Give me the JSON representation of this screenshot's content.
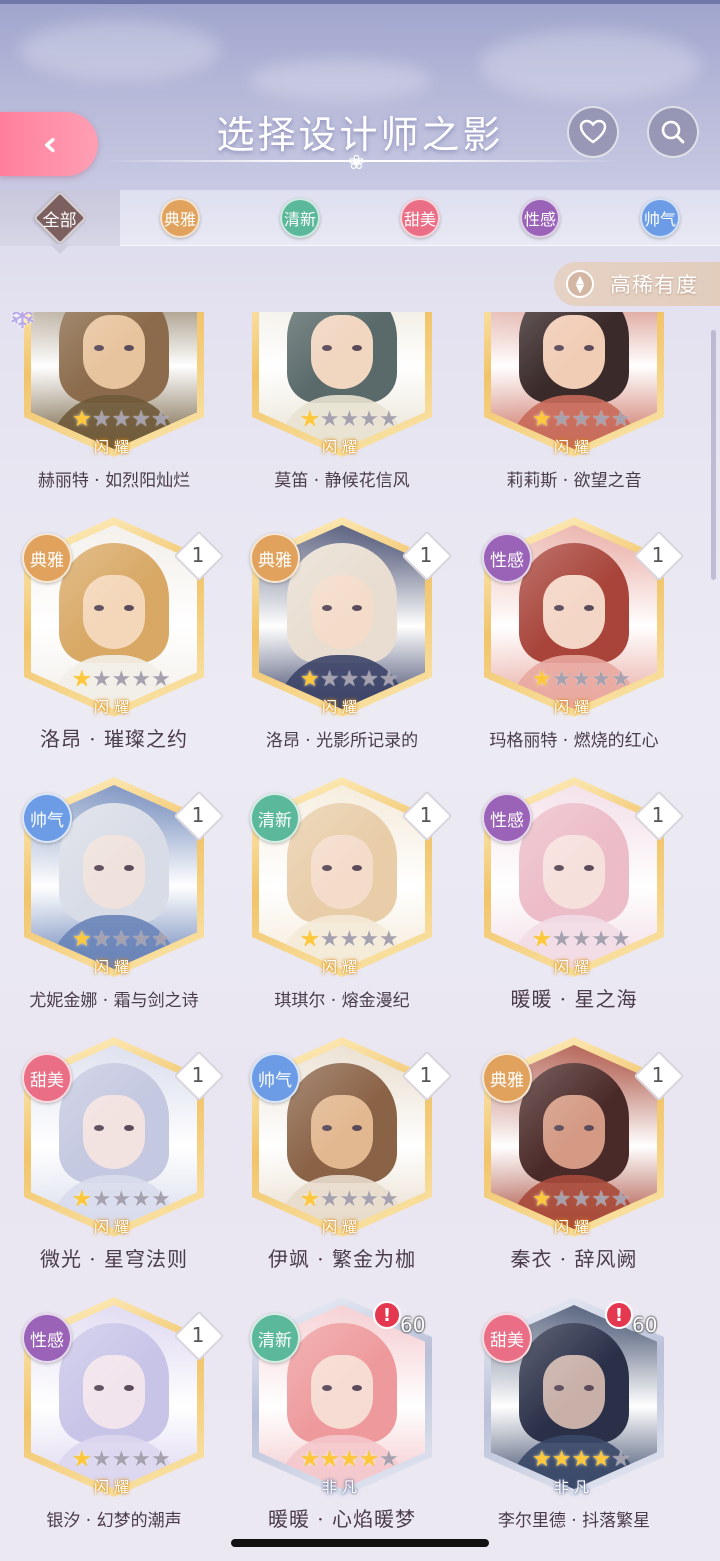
{
  "header": {
    "title": "选择设计师之影",
    "back_icon": "double-chevron-left-icon",
    "favorite_icon": "heart-icon",
    "search_icon": "search-icon",
    "accent": "#ff8fa8"
  },
  "tabs": [
    {
      "label": "全部",
      "color": "#7c6060",
      "active": true
    },
    {
      "label": "典雅",
      "color": "#e0a25c",
      "active": false
    },
    {
      "label": "清新",
      "color": "#5cb89a",
      "active": false
    },
    {
      "label": "甜美",
      "color": "#ea6f86",
      "active": false
    },
    {
      "label": "性感",
      "color": "#9a63b8",
      "active": false
    },
    {
      "label": "帅气",
      "color": "#6c9ce6",
      "active": false
    }
  ],
  "sort": {
    "label": "高稀有度",
    "icon": "sort-updown-icon"
  },
  "cards": [
    {
      "name": "赫丽特 · 如烈阳灿烂",
      "type": "",
      "count": "",
      "stars": 1,
      "rarity": "闪耀",
      "frame": "gold",
      "palette": [
        "#8b6b4b",
        "#e8c49e",
        "#6f5a3a"
      ],
      "extra": "snowflake"
    },
    {
      "name": "莫笛 · 静候花信风",
      "type": "",
      "count": "",
      "stars": 1,
      "rarity": "闪耀",
      "frame": "gold",
      "palette": [
        "#5a6a6a",
        "#f1d6c0",
        "#e8e2d2"
      ],
      "extra": ""
    },
    {
      "name": "莉莉斯 · 欲望之音",
      "type": "",
      "count": "",
      "stars": 1,
      "rarity": "闪耀",
      "frame": "gold",
      "palette": [
        "#3a2a2a",
        "#f1cdb6",
        "#c86a5a"
      ],
      "extra": ""
    },
    {
      "name": "洛昂 · 璀璨之约",
      "type": "典雅",
      "count": "1",
      "stars": 1,
      "rarity": "闪耀",
      "frame": "gold",
      "palette": [
        "#d8a864",
        "#f4d6b8",
        "#f2eee8"
      ],
      "extra": ""
    },
    {
      "name": "洛昂 · 光影所记录的",
      "type": "典雅",
      "count": "1",
      "stars": 1,
      "rarity": "闪耀",
      "frame": "gold",
      "palette": [
        "#e8ddd0",
        "#f4dccb",
        "#3c4468"
      ],
      "extra": ""
    },
    {
      "name": "玛格丽特 · 燃烧的红心",
      "type": "性感",
      "count": "1",
      "stars": 1,
      "rarity": "闪耀",
      "frame": "gold",
      "palette": [
        "#a8443a",
        "#f4d6c6",
        "#e8a8a0"
      ],
      "extra": ""
    },
    {
      "name": "尤妮金娜 · 霜与剑之诗",
      "type": "帅气",
      "count": "1",
      "stars": 1,
      "rarity": "闪耀",
      "frame": "gold",
      "palette": [
        "#d8dce6",
        "#efe2dc",
        "#6a84b8"
      ],
      "extra": ""
    },
    {
      "name": "琪琪尔 · 熔金漫纪",
      "type": "清新",
      "count": "1",
      "stars": 1,
      "rarity": "闪耀",
      "frame": "gold",
      "palette": [
        "#e8cda8",
        "#f4dccb",
        "#f4ead8"
      ],
      "extra": ""
    },
    {
      "name": "暖暖 · 星之海",
      "type": "性感",
      "count": "1",
      "stars": 1,
      "rarity": "闪耀",
      "frame": "gold",
      "palette": [
        "#ecbcc8",
        "#f6e0dc",
        "#f2dce6"
      ],
      "extra": ""
    },
    {
      "name": "微光 · 星穹法则",
      "type": "甜美",
      "count": "1",
      "stars": 1,
      "rarity": "闪耀",
      "frame": "gold",
      "palette": [
        "#c4c8e0",
        "#f2e2e0",
        "#d8dcec"
      ],
      "extra": ""
    },
    {
      "name": "伊飒 · 繁金为枷",
      "type": "帅气",
      "count": "1",
      "stars": 1,
      "rarity": "闪耀",
      "frame": "gold",
      "palette": [
        "#8a6246",
        "#e2b890",
        "#e8dccc"
      ],
      "extra": ""
    },
    {
      "name": "秦衣 · 辞风阙",
      "type": "典雅",
      "count": "1",
      "stars": 1,
      "rarity": "闪耀",
      "frame": "gold",
      "palette": [
        "#4a2a28",
        "#d49a84",
        "#a84a3a"
      ],
      "extra": ""
    },
    {
      "name": "银汐 · 幻梦的潮声",
      "type": "性感",
      "count": "1",
      "stars": 1,
      "rarity": "闪耀",
      "frame": "gold",
      "palette": [
        "#c8c4e8",
        "#f2e4ec",
        "#dcd6f0"
      ],
      "extra": ""
    },
    {
      "name": "暖暖 · 心焰暖梦",
      "type": "清新",
      "count": "60",
      "stars": 4,
      "rarity": "非凡",
      "frame": "silver",
      "palette": [
        "#ee9a9c",
        "#f6dcd2",
        "#f4c8cc"
      ],
      "extra": "alert"
    },
    {
      "name": "李尔里德 · 抖落繁星",
      "type": "甜美",
      "count": "60",
      "stars": 4,
      "rarity": "非凡",
      "frame": "silver",
      "palette": [
        "#2a3048",
        "#c8b0a8",
        "#3a4868"
      ],
      "extra": "alert"
    }
  ],
  "type_colors": {
    "典雅": "#e0a25c",
    "清新": "#5cb89a",
    "甜美": "#ea6f86",
    "性感": "#9a63b8",
    "帅气": "#6c9ce6"
  }
}
